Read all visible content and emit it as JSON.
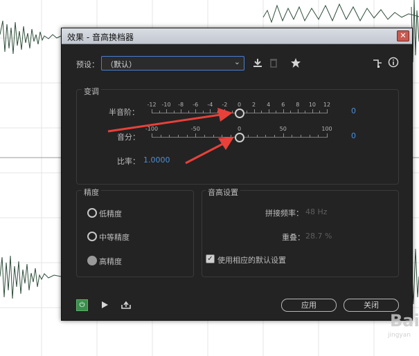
{
  "window": {
    "title": "效果 - 音高换档器",
    "close_glyph": "✕"
  },
  "toolbar": {
    "preset_label": "预设：",
    "preset_value": "（默认）",
    "icons": [
      "download-icon",
      "trash-icon",
      "star-icon",
      "routing-icon",
      "info-icon"
    ]
  },
  "pitch": {
    "title": "变调",
    "semitone_label": "半音阶：",
    "semitone_ticks": [
      "-12",
      "-10",
      "-8",
      "-6",
      "-4",
      "-2",
      "0",
      "2",
      "4",
      "6",
      "8",
      "10",
      "12"
    ],
    "semitone_value": "0",
    "semitone_level": 0,
    "cents_label": "音分：",
    "cents_ticks": [
      "-100",
      "-50",
      "0",
      "50",
      "100"
    ],
    "cents_value": "0",
    "cents_level": 0,
    "ratio_label": "比率：",
    "ratio_value": "1.0000"
  },
  "precision": {
    "title": "精度",
    "options": [
      {
        "label": "低精度",
        "selected": false
      },
      {
        "label": "中等精度",
        "selected": false
      },
      {
        "label": "高精度",
        "selected": true
      }
    ]
  },
  "settings": {
    "title": "音高设置",
    "splice_label": "拼接频率：",
    "splice_value": "48 Hz",
    "overlap_label": "重叠：",
    "overlap_value": "28.7 %",
    "default_check_label": "使用相应的默认设置",
    "default_checked": true,
    "check_glyph": "✓"
  },
  "footer": {
    "apply_label": "应用",
    "close_label": "关闭",
    "power_glyph": "⏻"
  },
  "watermark": {
    "text": "Bai",
    "sub": "jingyan"
  },
  "colors": {
    "accent": "#4a90d9",
    "arrow": "#e8413a",
    "power": "#3a8f4a"
  }
}
